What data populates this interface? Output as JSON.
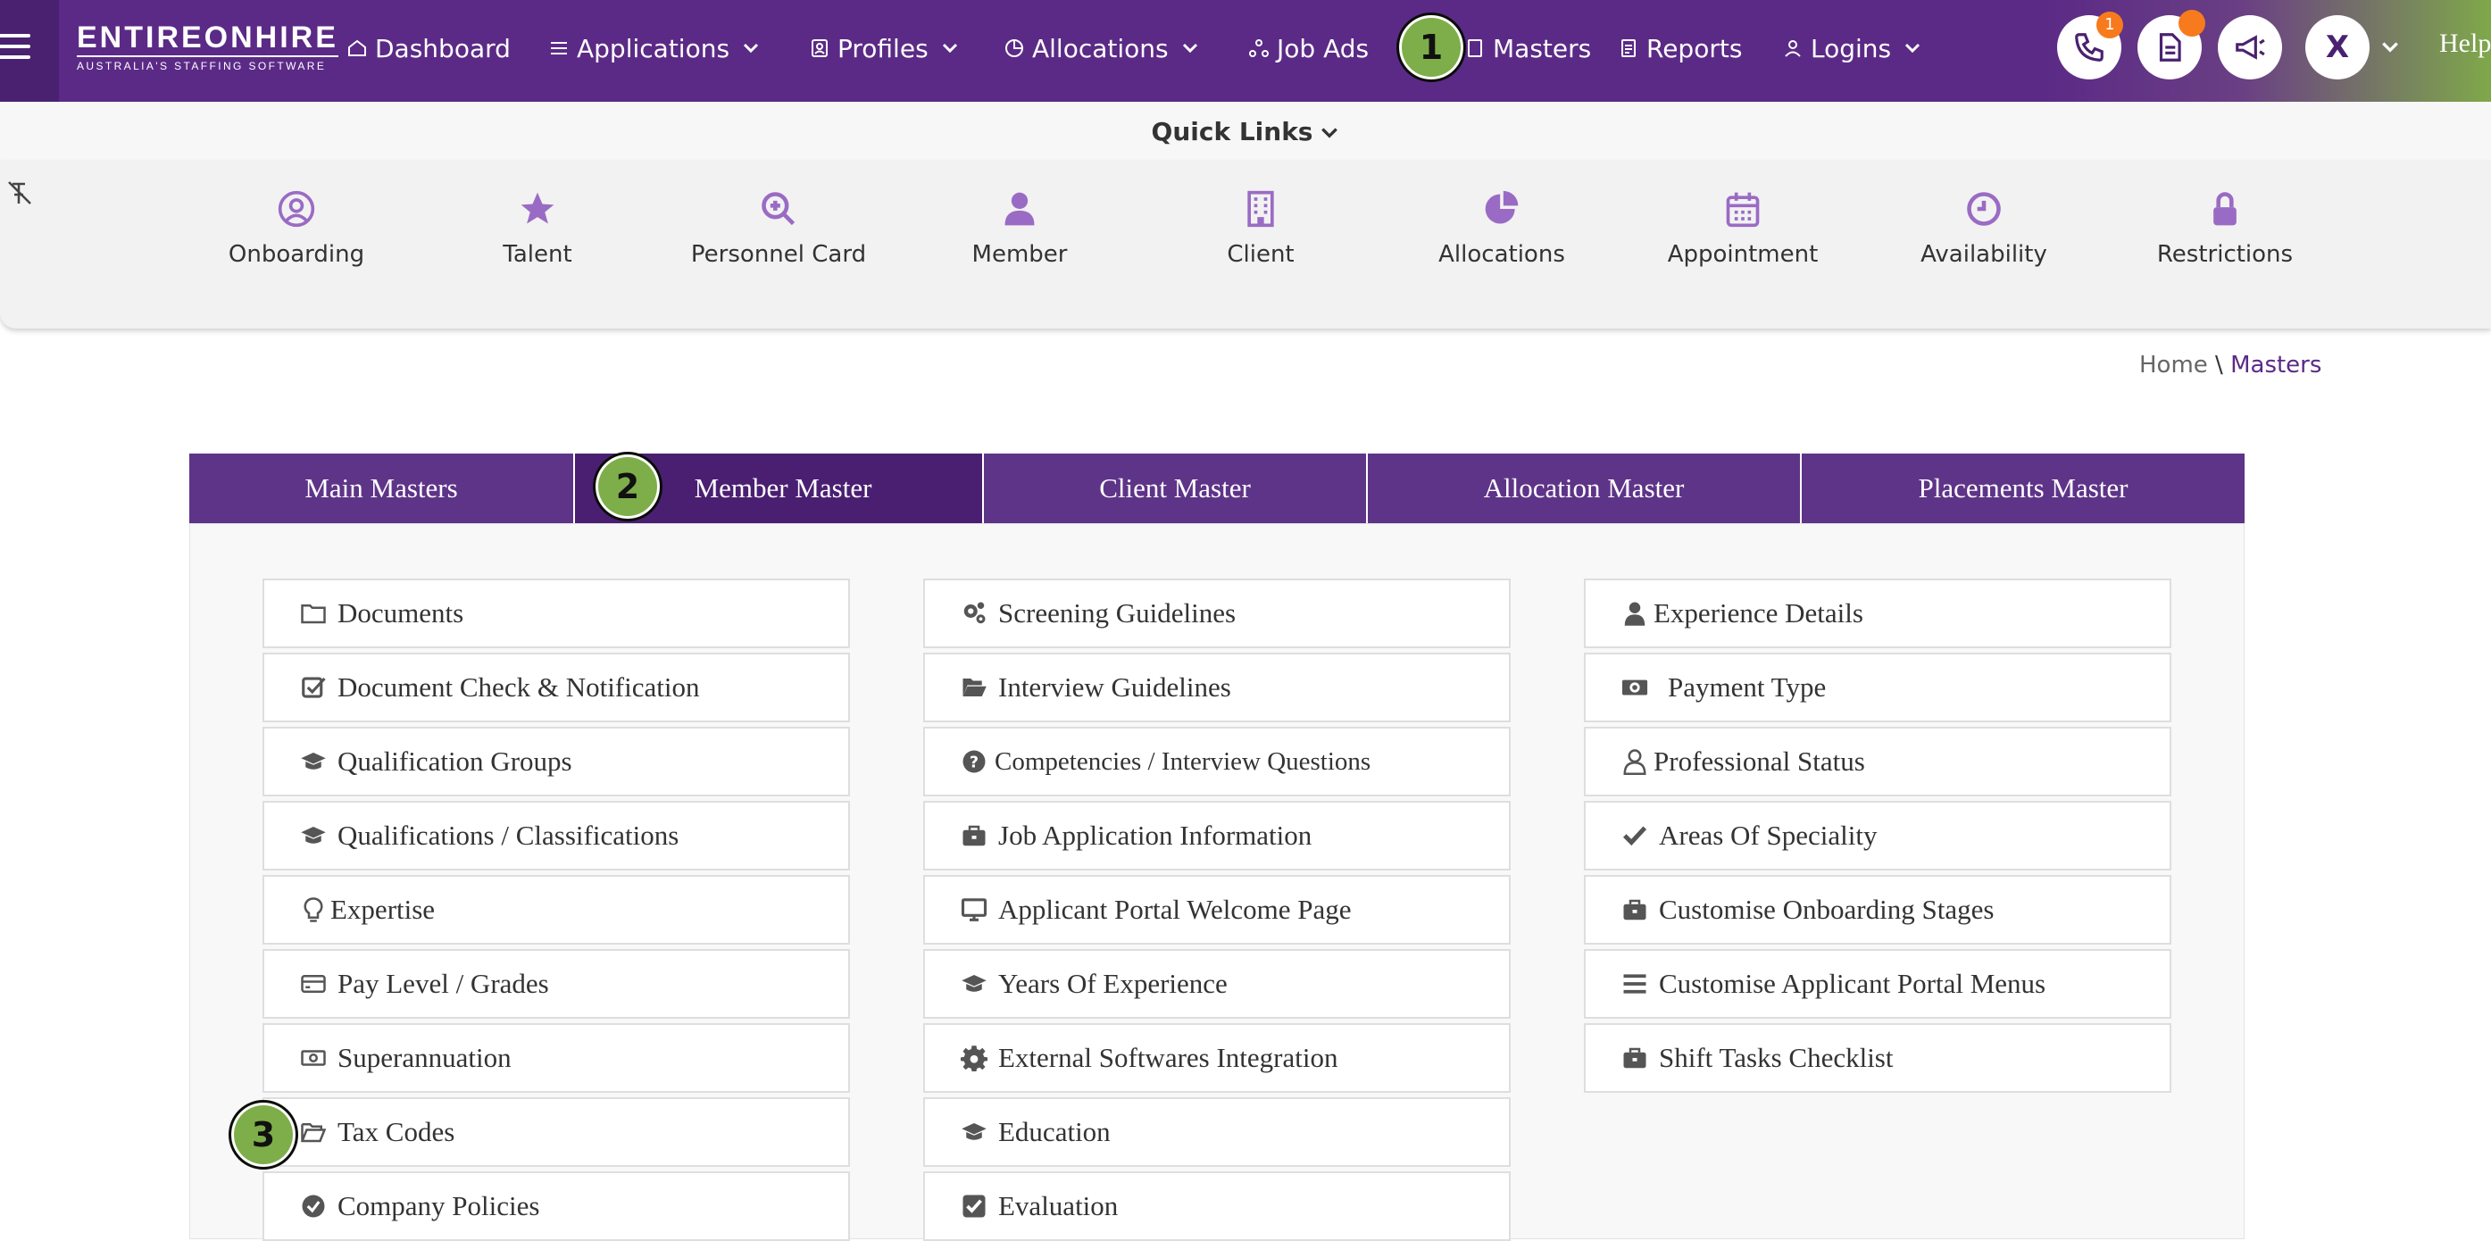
{
  "header": {
    "logo_name": "ENTIREONHIRE",
    "logo_tagline": "AUSTRALIA'S STAFFING SOFTWARE",
    "nav": [
      {
        "label": "Dashboard",
        "icon": "home-icon"
      },
      {
        "label": "Applications",
        "icon": "list-icon",
        "dropdown": true
      },
      {
        "label": "Profiles",
        "icon": "id-card-icon",
        "dropdown": true
      },
      {
        "label": "Allocations",
        "icon": "pie-icon",
        "dropdown": true
      },
      {
        "label": "Job Ads",
        "icon": "network-icon"
      },
      {
        "label": "Masters",
        "icon": "page-icon"
      },
      {
        "label": "Reports",
        "icon": "report-icon"
      },
      {
        "label": "Logins",
        "icon": "user-icon",
        "dropdown": true
      }
    ],
    "calls_badge": "1",
    "avatar_letter": "X",
    "help_label": "Help",
    "accent_color": "#5b2a86",
    "badge_color": "#f77b1c"
  },
  "quick_links": {
    "title": "Quick Links",
    "items": [
      {
        "label": "Onboarding",
        "icon": "user-circle-icon"
      },
      {
        "label": "Talent",
        "icon": "star-icon"
      },
      {
        "label": "Personnel Card",
        "icon": "search-plus-icon"
      },
      {
        "label": "Member",
        "icon": "user-icon"
      },
      {
        "label": "Client",
        "icon": "building-icon"
      },
      {
        "label": "Allocations",
        "icon": "pie-chart-icon"
      },
      {
        "label": "Appointment",
        "icon": "calendar-icon"
      },
      {
        "label": "Availability",
        "icon": "clock-icon"
      },
      {
        "label": "Restrictions",
        "icon": "lock-icon"
      }
    ]
  },
  "breadcrumb": {
    "home": "Home",
    "separator": "\\",
    "current": "Masters"
  },
  "tabs": [
    {
      "label": "Main Masters",
      "active": false
    },
    {
      "label": "Member Master",
      "active": true
    },
    {
      "label": "Client Master",
      "active": false
    },
    {
      "label": "Allocation Master",
      "active": false
    },
    {
      "label": "Placements Master",
      "active": false
    }
  ],
  "steps": [
    "1",
    "2",
    "3"
  ],
  "columns": [
    [
      {
        "label": "Documents",
        "icon": "folder-icon"
      },
      {
        "label": "Document Check & Notification",
        "icon": "check-square-icon"
      },
      {
        "label": "Qualification Groups",
        "icon": "graduation-cap-icon"
      },
      {
        "label": "Qualifications / Classifications",
        "icon": "graduation-cap-icon"
      },
      {
        "label": "Expertise",
        "icon": "lightbulb-icon"
      },
      {
        "label": "Pay Level / Grades",
        "icon": "credit-card-icon"
      },
      {
        "label": "Superannuation",
        "icon": "money-icon"
      },
      {
        "label": "Tax Codes",
        "icon": "folder-open-icon"
      },
      {
        "label": "Company Policies",
        "icon": "check-circle-icon"
      }
    ],
    [
      {
        "label": "Screening Guidelines",
        "icon": "cogs-icon"
      },
      {
        "label": "Interview Guidelines",
        "icon": "folder-open-icon"
      },
      {
        "label": "Competencies / Interview Questions",
        "icon": "question-circle-icon"
      },
      {
        "label": "Job Application Information",
        "icon": "briefcase-icon"
      },
      {
        "label": "Applicant Portal Welcome Page",
        "icon": "desktop-icon"
      },
      {
        "label": "Years Of Experience",
        "icon": "graduation-cap-icon"
      },
      {
        "label": "External Softwares Integration",
        "icon": "gear-icon"
      },
      {
        "label": "Education",
        "icon": "graduation-cap-icon"
      },
      {
        "label": "Evaluation",
        "icon": "check-square-icon"
      }
    ],
    [
      {
        "label": "Experience Details",
        "icon": "user-icon"
      },
      {
        "label": "Payment Type",
        "icon": "money-icon"
      },
      {
        "label": "Professional Status",
        "icon": "user-outline-icon"
      },
      {
        "label": "Areas Of Speciality",
        "icon": "check-icon"
      },
      {
        "label": "Customise Onboarding Stages",
        "icon": "briefcase-icon"
      },
      {
        "label": "Customise Applicant Portal Menus",
        "icon": "bars-icon"
      },
      {
        "label": "Shift Tasks Checklist",
        "icon": "briefcase-icon"
      }
    ]
  ]
}
